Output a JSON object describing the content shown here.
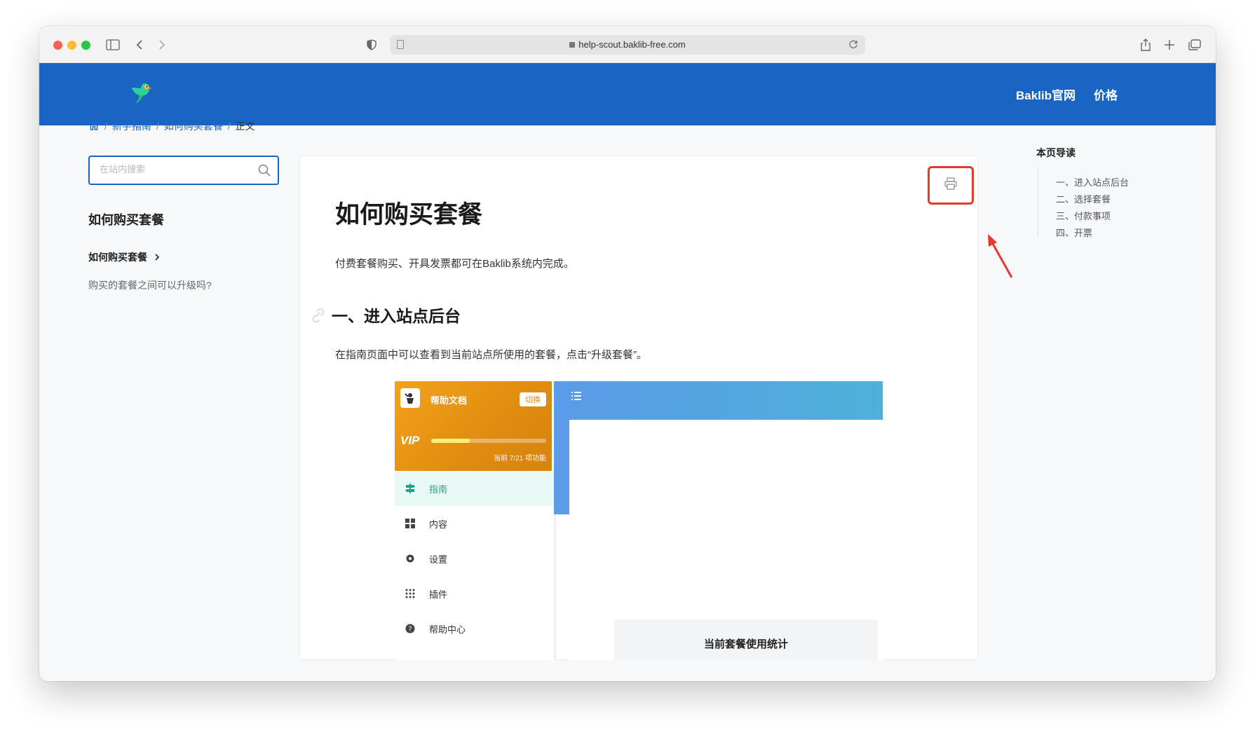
{
  "browser": {
    "url": "help-scout.baklib-free.com"
  },
  "header": {
    "nav": [
      "Baklib官网",
      "价格"
    ],
    "brand_color": "#1a65c4"
  },
  "breadcrumb": {
    "items": [
      "新手指南",
      "如何购买套餐",
      "正文"
    ]
  },
  "sidebar": {
    "search_placeholder": "在站内搜索",
    "section_title": "如何购买套餐",
    "items": [
      {
        "label": "如何购买套餐",
        "active": true
      },
      {
        "label": "购买的套餐之间可以升级吗?",
        "active": false
      }
    ]
  },
  "article": {
    "title": "如何购买套餐",
    "intro": "付费套餐购买、开具发票都可在Baklib系统内完成。",
    "section1_title": "一、进入站点后台",
    "section1_text": "在指南页面中可以查看到当前站点所使用的套餐，点击“升级套餐”。"
  },
  "embedded_screenshot": {
    "card_title": "帮助文档",
    "switch_label": "切换",
    "vip_label": "VIP",
    "vip_progress_fraction": 0.333,
    "feature_count": "当前 7/21 项功能",
    "menu": [
      {
        "label": "指南",
        "icon": "signpost-icon",
        "active": true
      },
      {
        "label": "内容",
        "icon": "grid-icon",
        "active": false
      },
      {
        "label": "设置",
        "icon": "gear-icon",
        "active": false
      },
      {
        "label": "插件",
        "icon": "dots-grid-icon",
        "active": false
      },
      {
        "label": "帮助中心",
        "icon": "help-icon",
        "active": false
      }
    ],
    "stats_title": "当前套餐使用统计"
  },
  "toc": {
    "title": "本页导读",
    "items": [
      "一、进入站点后台",
      "二、选择套餐",
      "三、付款事项",
      "四、开票"
    ]
  },
  "colors": {
    "annotation_red": "#e23b2e",
    "accent_teal": "#1aa489"
  }
}
